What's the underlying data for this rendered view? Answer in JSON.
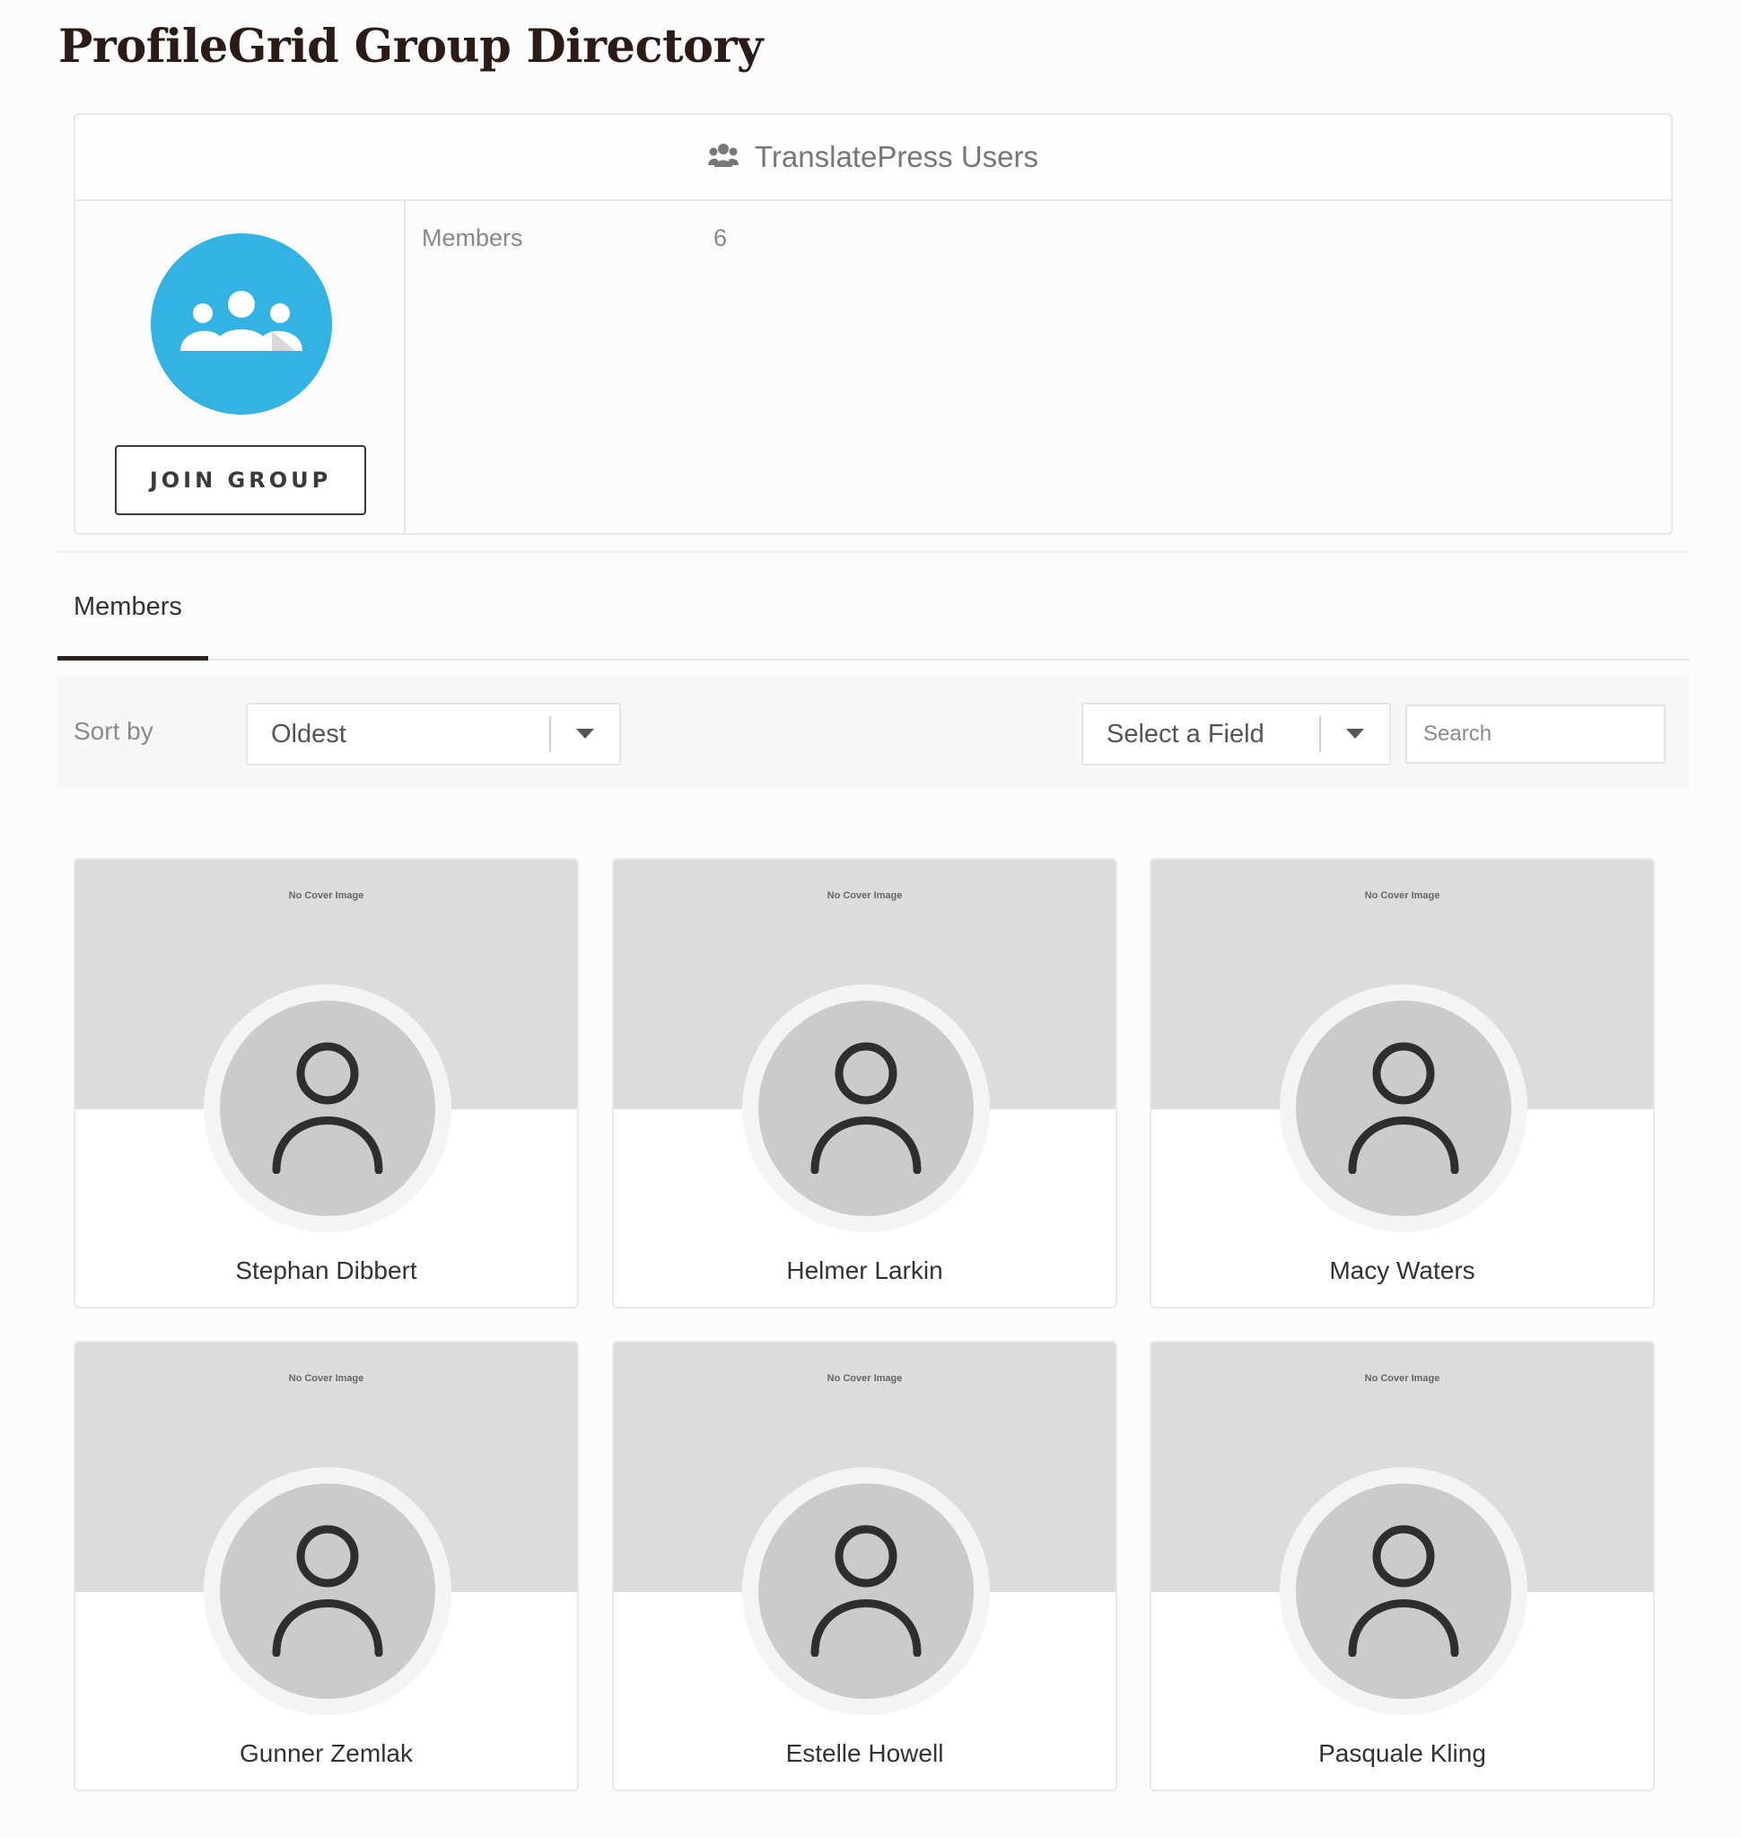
{
  "page": {
    "title": "ProfileGrid Group Directory"
  },
  "group": {
    "name": "TranslatePress Users",
    "join_label": "JOIN GROUP",
    "members_label": "Members",
    "members_count": "6",
    "avatar_color": "#33b3e2"
  },
  "tabs": [
    {
      "label": "Members",
      "active": true
    }
  ],
  "filters": {
    "sort_label": "Sort by",
    "sort_value": "Oldest",
    "field_value": "Select a Field",
    "search_placeholder": "Search"
  },
  "members": [
    {
      "name": "Stephan Dibbert",
      "cover_text": "No Cover Image"
    },
    {
      "name": "Helmer Larkin",
      "cover_text": "No Cover Image"
    },
    {
      "name": "Macy Waters",
      "cover_text": "No Cover Image"
    },
    {
      "name": "Gunner Zemlak",
      "cover_text": "No Cover Image"
    },
    {
      "name": "Estelle Howell",
      "cover_text": "No Cover Image"
    },
    {
      "name": "Pasquale Kling",
      "cover_text": "No Cover Image"
    }
  ]
}
